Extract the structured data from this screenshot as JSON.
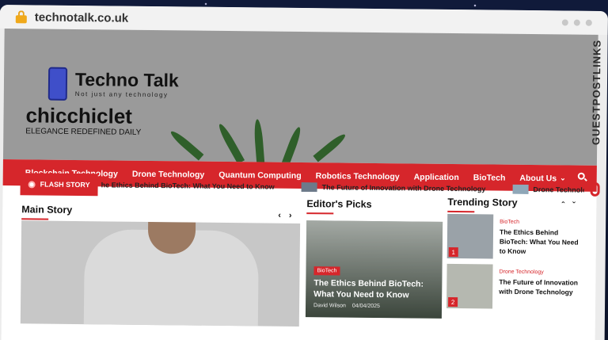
{
  "browser": {
    "url": "technotalk.co.uk"
  },
  "hero": {
    "logo_title": "Techno Talk",
    "logo_tagline": "Not just any technology",
    "site_title": "chicchiclet",
    "site_description": "ELEGANCE REDEFINED DAILY"
  },
  "nav": {
    "items": [
      {
        "label": "Blockchain Technology"
      },
      {
        "label": "Drone Technology"
      },
      {
        "label": "Quantum Computing"
      },
      {
        "label": "Robotics Technology"
      },
      {
        "label": "Application"
      },
      {
        "label": "BioTech"
      },
      {
        "label": "About Us"
      }
    ]
  },
  "flash": {
    "label": "FLASH STORY",
    "items": [
      {
        "text": "he Ethics Behind BioTech: What You Need to Know"
      },
      {
        "text": "The Future of Innovation with Drone Technology"
      },
      {
        "text": "Drone Technology Applicat"
      }
    ]
  },
  "sections": {
    "main_story": "Main Story",
    "editors_picks": "Editor's Picks",
    "trending_story": "Trending Story"
  },
  "editor_card": {
    "category": "BioTech",
    "headline": "The Ethics Behind BioTech: What You Need to Know",
    "author": "David Wilson",
    "date": "04/04/2025"
  },
  "trending": [
    {
      "num": "1",
      "category": "BioTech",
      "title": "The Ethics Behind BioTech: What You Need to Know"
    },
    {
      "num": "2",
      "category": "Drone Technology",
      "title": "The Future of Innovation with Drone Technology"
    }
  ],
  "watermark": {
    "text": "GUESTPOSTLINKS"
  },
  "colors": {
    "accent": "#d6262b",
    "hero_bg": "#9a9a9a"
  }
}
